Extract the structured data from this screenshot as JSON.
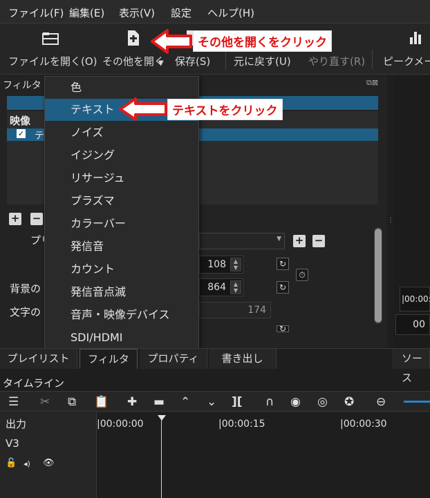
{
  "menu": [
    "ファイル(F)",
    "編集(E)",
    "表示(V)",
    "設定",
    "ヘルプ(H)"
  ],
  "toolbar": {
    "open_file": "ファイルを開く(O)",
    "open_other": "その他を開く",
    "save": "保存(S)",
    "undo": "元に戻す(U)",
    "redo": "やり直す(R)",
    "peak_meter": "ピークメー"
  },
  "callouts": {
    "open_other": "その他を開くをクリック",
    "text": "テキストをクリック"
  },
  "filter_panel": {
    "title": "フィルタ",
    "section_video": "映像",
    "item_prefix": "テ",
    "preset_label": "プリ",
    "bg_label": "背景の",
    "text_label": "文字の",
    "value_108": "108",
    "value_864": "864",
    "value_174": "174"
  },
  "dropdown_items": [
    "色",
    "テキスト",
    "ノイズ",
    "イジング",
    "リサージュ",
    "プラズマ",
    "カラーバー",
    "発信音",
    "カウント",
    "発信音点滅",
    "音声・映像デバイス",
    "SDI/HDMI"
  ],
  "right_panel": {
    "timecode1": "|00:00:0",
    "timecode2": "00"
  },
  "tabs": [
    "プレイリスト",
    "フィルタ",
    "プロパティ",
    "書き出し",
    "ソース"
  ],
  "timeline": {
    "title": "タイムライン",
    "output_label": "出力",
    "track_v3": "V3",
    "ruler": [
      "|00:00:00",
      "|00:00:15",
      "|00:00:30"
    ]
  },
  "colors": {
    "accent": "#1f5f86",
    "callout_text": "#d11111",
    "arrow_red": "#e01b1b"
  }
}
